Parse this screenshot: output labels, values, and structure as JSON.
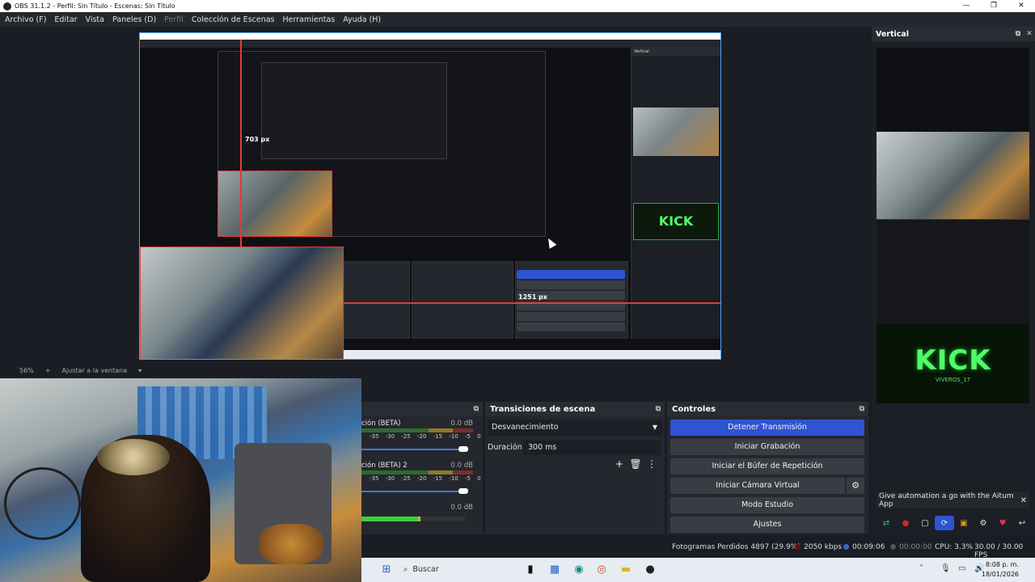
{
  "window": {
    "title": "OBS 31.1.2 - Perfil: Sin Título - Escenas: Sin Título"
  },
  "menu": [
    "Archivo (F)",
    "Editar",
    "Vista",
    "Paneles (D)",
    "Perfil",
    "Colección de Escenas",
    "Herramientas",
    "Ayuda (H)"
  ],
  "preview": {
    "nested_measure_1": "703 px",
    "nested_measure_2": "1251 px",
    "nested_kick": "KICK"
  },
  "zoom": {
    "level": "56%",
    "fit_label": "Ajustar a la ventana"
  },
  "vertical_dock": {
    "title": "Vertical",
    "kick_big": "KICK",
    "kick_small": "VIVEROS_17",
    "notification": "Give automation a go with the Aitum App"
  },
  "audio": {
    "channels": [
      {
        "name": "ción (BETA)",
        "db": "0.0 dB"
      },
      {
        "name": "ción (BETA) 2",
        "db": "0.0 dB"
      },
      {
        "name": "",
        "db": "0.0 dB"
      }
    ],
    "ticks": "-35 -30 -25 -20 -15 -10 -5 0"
  },
  "transitions": {
    "title": "Transiciones de escena",
    "selected": "Desvanecimiento",
    "duration_label": "Duración",
    "duration_value": "300 ms"
  },
  "controls": {
    "title": "Controles",
    "buttons": [
      "Detener Transmisión",
      "Iniciar Grabación",
      "Iniciar el Búfer de Repetición",
      "Iniciar Cámara Virtual",
      "Modo Estudio",
      "Ajustes"
    ]
  },
  "stats": {
    "dropped": "Fotogramas Perdidos 4897 (29.9%)",
    "bitrate": "2050 kbps",
    "stream_time": "00:09:06",
    "rec_time": "00:00:00",
    "cpu": "CPU: 3.3%",
    "fps": "30.00 / 30.00 FPS"
  },
  "taskbar": {
    "search": "Buscar",
    "time": "8:08 p. m.",
    "date": "18/01/2026"
  },
  "colors": {
    "accent": "#2f54d2",
    "selection": "#e23a3a",
    "kick_green": "#4dff66"
  }
}
